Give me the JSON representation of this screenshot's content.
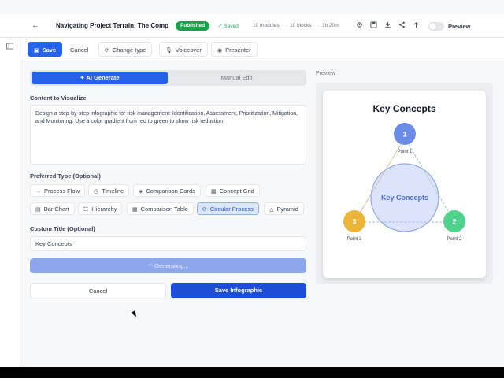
{
  "topbar": {
    "back_icon": "arrow-left-icon",
    "title": "Navigating Project Terrain: The Compreh",
    "status": "Published",
    "saved": "✓ Saved",
    "modules": "10 modules",
    "blocks": "10 blocks",
    "duration": "1h 20m",
    "preview_label": "Preview"
  },
  "toolbar": {
    "save": "Save",
    "cancel": "Cancel",
    "change_type": "Change type",
    "voiceover": "Voiceover",
    "presenter": "Presenter"
  },
  "editor": {
    "tab_ai": "AI Generate",
    "tab_manual": "Manual Edit",
    "content_label": "Content to Visualize",
    "content_text": "Design a step-by-step infographic for risk management: Identification, Assessment, Prioritization, Mitigation, and Monitoring. Use a color gradient from red to green to show risk reduction",
    "type_label": "Preferred Type (Optional)",
    "types": {
      "process_flow": "Process Flow",
      "timeline": "Timeline",
      "comparison_cards": "Comparison Cards",
      "concept_grid": "Concept Grid",
      "bar_chart": "Bar Chart",
      "hierarchy": "Hierarchy",
      "comparison_table": "Comparison Table",
      "circular_process": "Circular Process",
      "pyramid": "Pyramid"
    },
    "selected_type": "Circular Process",
    "title_label": "Custom Title (Optional)",
    "title_value": "Key Concepts",
    "generating": "Generating...",
    "cancel": "Cancel",
    "save_infographic": "Save Infographic"
  },
  "preview": {
    "label": "Preview",
    "card_title": "Key Concepts",
    "center": "Key Concepts",
    "points": [
      {
        "num": "1",
        "label": "Point 1",
        "color": "#6b8be8"
      },
      {
        "num": "2",
        "label": "Point 2",
        "color": "#4fd28a"
      },
      {
        "num": "3",
        "label": "Point 3",
        "color": "#e9b63a"
      }
    ]
  },
  "colors": {
    "primary": "#2563eb",
    "published": "#16a34a"
  }
}
